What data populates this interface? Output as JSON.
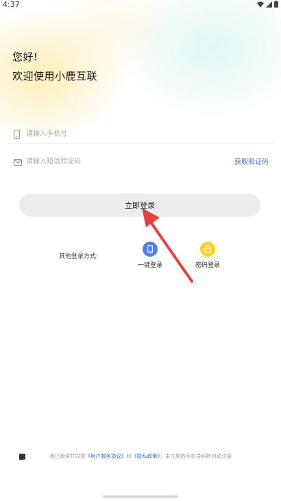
{
  "status_bar": {
    "time": "4:37",
    "icons": [
      "wifi-icon",
      "signal-icon",
      "battery-icon"
    ]
  },
  "greeting": {
    "line1": "您好!",
    "line2": "欢迎使用小鹿互联"
  },
  "phone_field": {
    "placeholder": "请输入手机号",
    "value": ""
  },
  "code_field": {
    "placeholder": "请输入短信验证码",
    "value": "",
    "get_code_label": "获取验证码"
  },
  "login_button": {
    "label": "立即登录"
  },
  "other_login": {
    "label": "其他登录方式:",
    "options": [
      {
        "label": "一键登录",
        "icon": "phone-icon",
        "color": "#4d7ff0"
      },
      {
        "label": "密码登录",
        "icon": "lock-icon",
        "color": "#ffd21f"
      }
    ]
  },
  "agreement": {
    "checked": true,
    "prefix": "我已阅读并同意",
    "terms_link": "《用户服务协议》",
    "and": "和",
    "privacy_link": "《隐私政策》",
    "suffix": "；未注册的手机号码将自动注册"
  },
  "colors": {
    "accent": "#2f6fd6",
    "annotation_arrow": "#e8413c"
  }
}
